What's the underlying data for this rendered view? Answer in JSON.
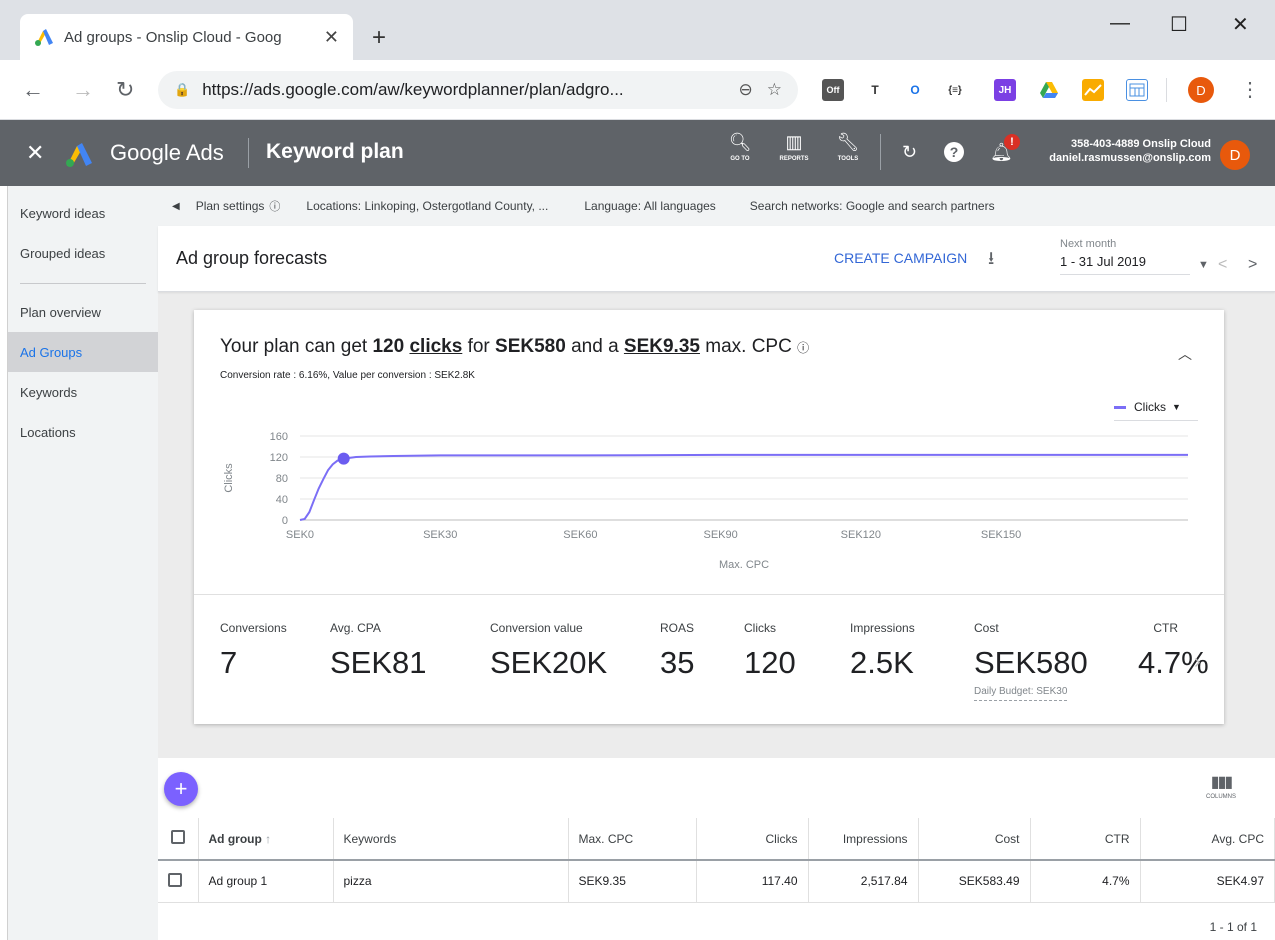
{
  "browser": {
    "tab_title": "Ad groups - Onslip Cloud - Goog",
    "url": "https://ads.google.com/aw/keywordplanner/plan/adgro...",
    "profile_initial": "D",
    "extensions": [
      "T",
      "{≡}",
      "JH"
    ]
  },
  "header": {
    "brand": "Google Ads",
    "page": "Keyword plan",
    "tools": [
      {
        "icon": "search-icon",
        "label": "GO TO"
      },
      {
        "icon": "reports-icon",
        "label": "REPORTS"
      },
      {
        "icon": "wrench-icon",
        "label": "TOOLS"
      }
    ],
    "account_line1": "358-403-4889 Onslip Cloud",
    "account_line2": "daniel.rasmussen@onslip.com",
    "avatar_initial": "D"
  },
  "sidebar": {
    "items": [
      "Keyword ideas",
      "Grouped ideas",
      "Plan overview",
      "Ad Groups",
      "Keywords",
      "Locations"
    ],
    "active": "Ad Groups"
  },
  "settings": {
    "plan_settings": "Plan settings",
    "locations": "Locations: Linkoping, Ostergotland County, ...",
    "language": "Language: All languages",
    "networks": "Search networks: Google and search partners"
  },
  "forecast": {
    "title": "Ad group forecasts",
    "create_campaign": "CREATE CAMPAIGN",
    "period_label": "Next month",
    "period_range": "1 - 31 Jul 2019"
  },
  "summary": {
    "prefix": "Your plan can get ",
    "clicks_num": "120",
    "clicks_word": "clicks",
    "for": " for ",
    "cost": "SEK580",
    "and_a": " and a ",
    "max_cpc": "SEK9.35",
    "suffix": " max. CPC",
    "subline": "Conversion rate : 6.16%, Value per conversion : SEK2.8K",
    "legend": "Clicks"
  },
  "chart_data": {
    "type": "line",
    "ylabel": "Clicks",
    "xlabel": "Max. CPC",
    "y_ticks": [
      "0",
      "40",
      "80",
      "120",
      "160"
    ],
    "x_ticks": [
      "SEK0",
      "SEK30",
      "SEK60",
      "SEK90",
      "SEK120",
      "SEK150"
    ],
    "ylim": [
      0,
      160
    ],
    "xlim": [
      0,
      190
    ],
    "series": [
      {
        "name": "Clicks",
        "color": "#7b6ef6",
        "x": [
          0,
          1,
          2,
          3,
          4,
          5,
          6,
          7,
          8,
          9.35,
          12,
          15,
          20,
          30,
          60,
          90,
          120,
          150,
          190
        ],
        "values": [
          0,
          2,
          15,
          38,
          60,
          78,
          95,
          106,
          113,
          117,
          120,
          121,
          122,
          123,
          123,
          124,
          124,
          124,
          124
        ]
      }
    ],
    "highlight": {
      "x": 9.35,
      "y": 117
    }
  },
  "metrics": [
    {
      "label": "Conversions",
      "value": "7"
    },
    {
      "label": "Avg. CPA",
      "value": "SEK81"
    },
    {
      "label": "Conversion value",
      "value": "SEK20K"
    },
    {
      "label": "ROAS",
      "value": "35"
    },
    {
      "label": "Clicks",
      "value": "120"
    },
    {
      "label": "Impressions",
      "value": "2.5K"
    },
    {
      "label": "Cost",
      "value": "SEK580",
      "note": "Daily Budget: SEK30"
    },
    {
      "label": "CTR",
      "value": "4.7%"
    }
  ],
  "table": {
    "columns_label": "COLUMNS",
    "headers": [
      "Ad group",
      "Keywords",
      "Max. CPC",
      "Clicks",
      "Impressions",
      "Cost",
      "CTR",
      "Avg. CPC"
    ],
    "rows": [
      [
        "Ad group 1",
        "pizza",
        "SEK9.35",
        "117.40",
        "2,517.84",
        "SEK583.49",
        "4.7%",
        "SEK4.97"
      ]
    ],
    "pager": "1 - 1 of 1"
  },
  "colors": {
    "accent": "#7b6ef6",
    "link": "#3367d6",
    "header_bg": "#5f6368"
  }
}
